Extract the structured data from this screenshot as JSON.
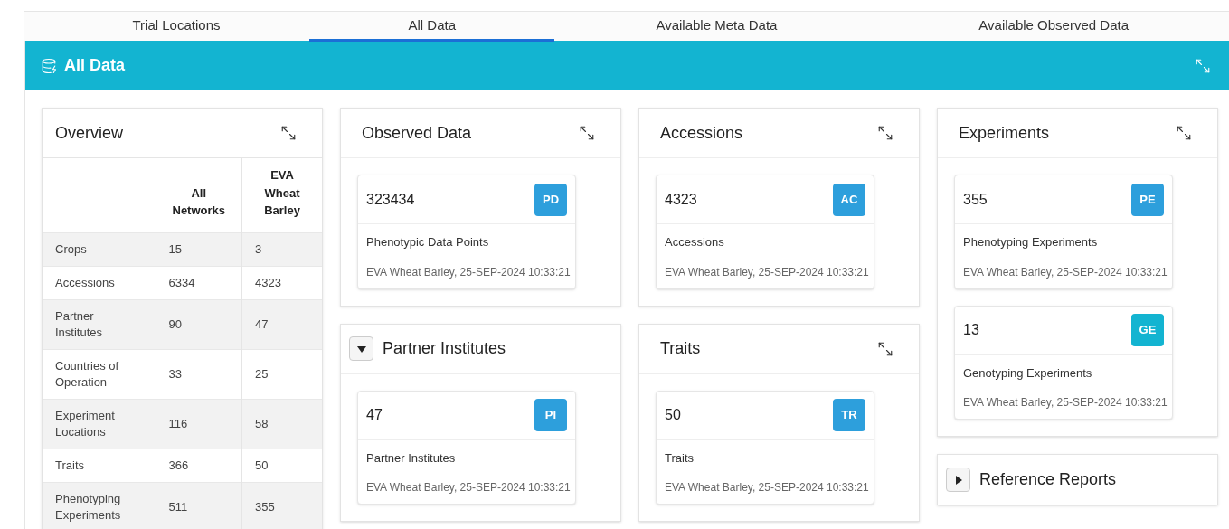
{
  "tabs": [
    {
      "label": "Trial Locations",
      "selected": false
    },
    {
      "label": "All Data",
      "selected": true
    },
    {
      "label": "Available Meta Data",
      "selected": false
    },
    {
      "label": "Available Observed Data",
      "selected": false
    }
  ],
  "region": {
    "title": "All Data"
  },
  "overview": {
    "title": "Overview",
    "columns": [
      "All Networks",
      "EVA Wheat Barley"
    ],
    "rows": [
      {
        "label": "Crops",
        "values": [
          "15",
          "3"
        ]
      },
      {
        "label": "Accessions",
        "values": [
          "6334",
          "4323"
        ]
      },
      {
        "label": "Partner Institutes",
        "values": [
          "90",
          "47"
        ]
      },
      {
        "label": "Countries of Operation",
        "values": [
          "33",
          "25"
        ]
      },
      {
        "label": "Experiment Locations",
        "values": [
          "116",
          "58"
        ]
      },
      {
        "label": "Traits",
        "values": [
          "366",
          "50"
        ]
      },
      {
        "label": "Phenotyping Experiments",
        "values": [
          "511",
          "355"
        ]
      }
    ]
  },
  "columns": [
    [
      {
        "kind": "plain",
        "title": "Observed Data",
        "cards": [
          {
            "value": "323434",
            "badge": "PD",
            "color": "#2d9fdc",
            "label": "Phenotypic Data Points",
            "source": "EVA Wheat Barley, 25-SEP-2024 10:33:21"
          }
        ]
      },
      {
        "kind": "collapsible",
        "title": "Partner Institutes",
        "expanded": true,
        "cards": [
          {
            "value": "47",
            "badge": "PI",
            "color": "#2d9fdc",
            "label": "Partner Institutes",
            "source": "EVA Wheat Barley, 25-SEP-2024 10:33:21"
          }
        ]
      }
    ],
    [
      {
        "kind": "plain",
        "title": "Accessions",
        "cards": [
          {
            "value": "4323",
            "badge": "AC",
            "color": "#2d9fdc",
            "label": "Accessions",
            "source": "EVA Wheat Barley, 25-SEP-2024 10:33:21"
          }
        ]
      },
      {
        "kind": "plain",
        "title": "Traits",
        "cards": [
          {
            "value": "50",
            "badge": "TR",
            "color": "#2d9fdc",
            "label": "Traits",
            "source": "EVA Wheat Barley, 25-SEP-2024 10:33:21"
          }
        ]
      }
    ],
    [
      {
        "kind": "plain",
        "title": "Experiments",
        "cards": [
          {
            "value": "355",
            "badge": "PE",
            "color": "#2d9fdc",
            "label": "Phenotyping Experiments",
            "source": "EVA Wheat Barley, 25-SEP-2024 10:33:21"
          },
          {
            "value": "13",
            "badge": "GE",
            "color": "#13b4d1",
            "label": "Genotyping Experiments",
            "source": "EVA Wheat Barley, 25-SEP-2024 10:33:21"
          }
        ]
      },
      {
        "kind": "collapsible",
        "title": "Reference Reports",
        "expanded": false
      }
    ]
  ]
}
